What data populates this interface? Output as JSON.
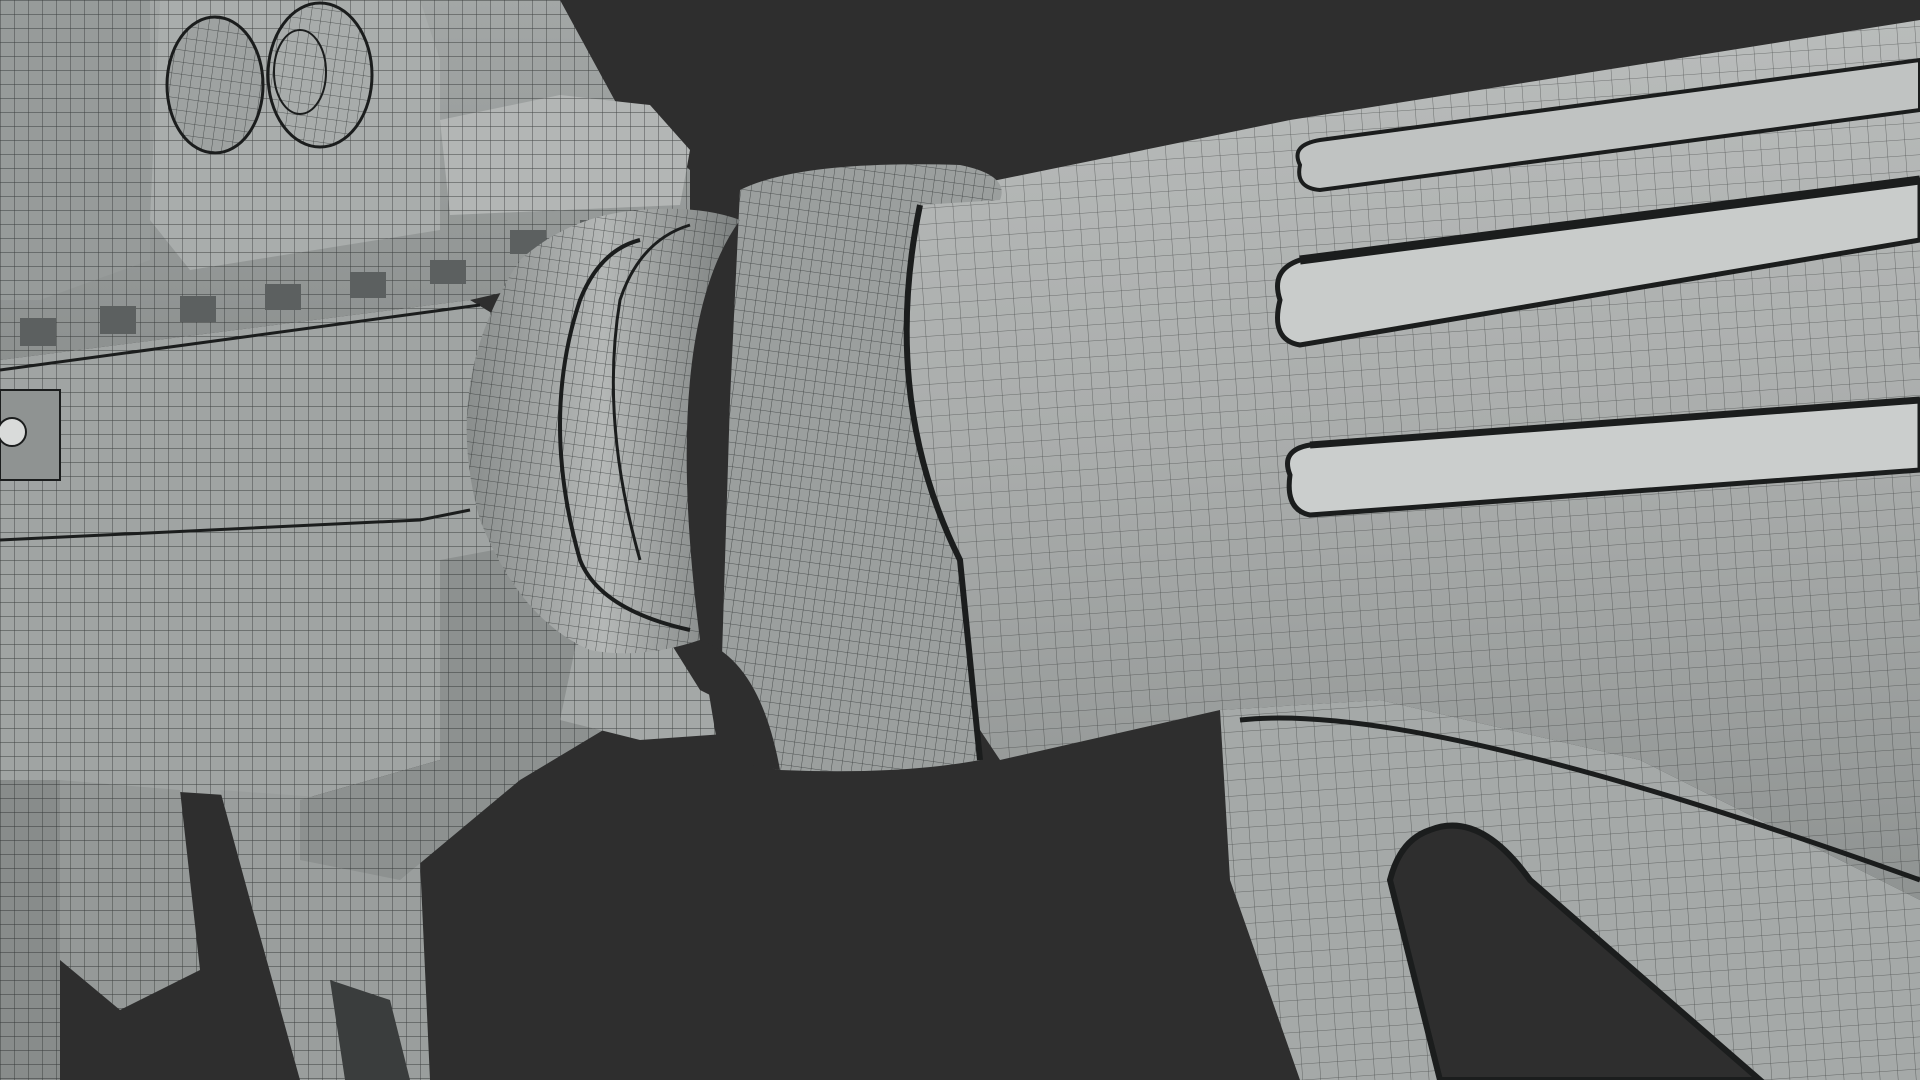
{
  "viewport": {
    "background_color": "#2e2e2e",
    "mesh_surface_color": "#a6a9a8",
    "mesh_shadow_color": "#7f8382",
    "mesh_highlight_color": "#c4c7c6",
    "wire_color": "#1b1d1d",
    "display_mode": "wireframe-overlay",
    "subject": "rifle-stock"
  }
}
